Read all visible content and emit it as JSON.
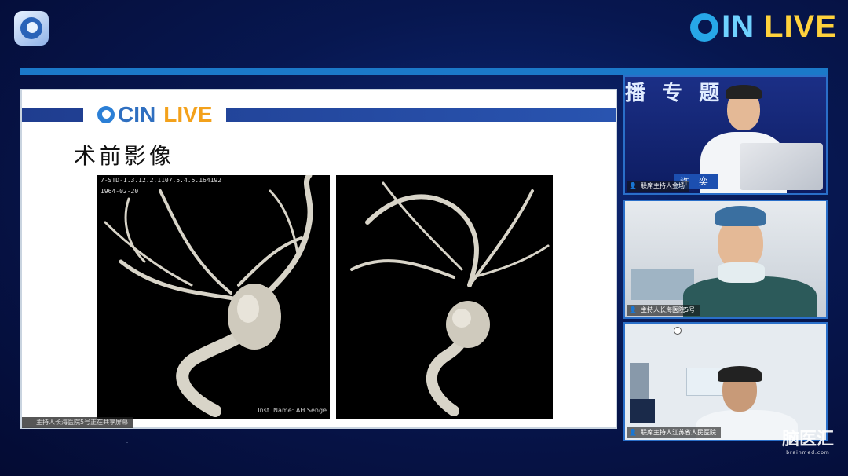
{
  "brand": {
    "prefix": "C",
    "main": "IN",
    "suffix": "LIVE"
  },
  "slide": {
    "brand_cin": "CIN",
    "brand_live": "LIVE",
    "title": "术前影像",
    "scan1": {
      "meta_line1": "7-STD-1.3.12.2.1107.5.4.5.164192",
      "meta_line2": "1964-02-20",
      "inst": "Inst. Name: AH Senge"
    }
  },
  "share_notice": "主持人长海医院5号正在共享屏幕",
  "tiles": [
    {
      "banner": "播 专 题",
      "name_plate": "许 奕",
      "label": "联席主持人金场"
    },
    {
      "label": "主持人长海医院5号"
    },
    {
      "label": "联席主持人江苏省人民医院"
    }
  ],
  "watermark": {
    "main": "脑医汇",
    "sub": "brainmed.com"
  },
  "colors": {
    "accent": "#1b79c9",
    "brand_cyan": "#6fd2ff",
    "brand_yellow": "#ffd23c",
    "slide_orange": "#f3a11b"
  }
}
